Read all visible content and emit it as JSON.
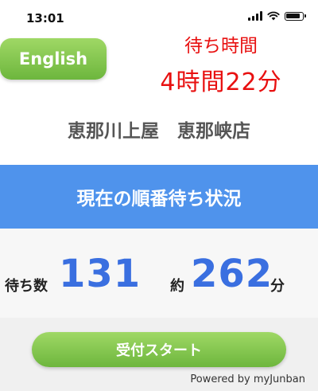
{
  "status_bar": {
    "time": "13:01"
  },
  "language_button": {
    "label": "English"
  },
  "wait_time": {
    "title": "待ち時間",
    "value": "4時間22分"
  },
  "store": {
    "name": "恵那川上屋　恵那峡店"
  },
  "banner": {
    "title": "現在の順番待ち状況"
  },
  "queue": {
    "waiting_label": "待ち数",
    "waiting_count": "131",
    "approx_label": "約",
    "approx_minutes": "262",
    "minutes_unit": "分"
  },
  "start_button": {
    "label": "受付スタート"
  },
  "footer": {
    "powered_by": "Powered by myJunban"
  },
  "colors": {
    "accent_green": "#7cc446",
    "banner_blue": "#4f93ec",
    "count_blue": "#3a6fe0",
    "wait_red": "#e81010"
  }
}
